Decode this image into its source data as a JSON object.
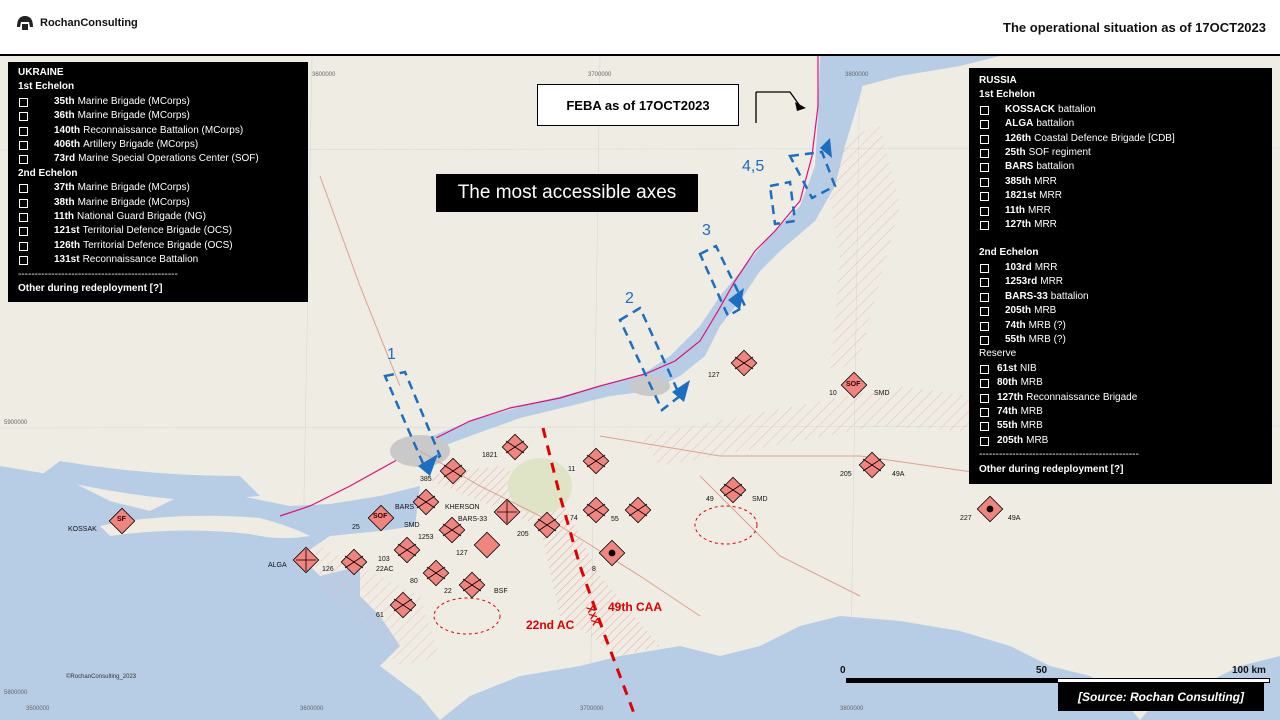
{
  "header": {
    "brand": "RochanConsulting",
    "title": "The operational situation as of 17OCT2023"
  },
  "ukraine": {
    "title": "UKRAINE",
    "echelon1_title": "1st Echelon",
    "echelon1": [
      {
        "num": "35th",
        "name": "Marine Brigade (MCorps)"
      },
      {
        "num": "36th",
        "name": "Marine Brigade (MCorps)"
      },
      {
        "num": "140th",
        "name": "Reconnaissance Battalion (MCorps)"
      },
      {
        "num": "406th",
        "name": "Artillery Brigade (MCorps)"
      },
      {
        "num": "73rd",
        "name": "Marine Special Operations Center (SOF)"
      }
    ],
    "echelon2_title": "2nd Echelon",
    "echelon2": [
      {
        "num": "37th",
        "name": "Marine Brigade (MCorps)"
      },
      {
        "num": "38th",
        "name": "Marine Brigade (MCorps)"
      },
      {
        "num": "11th",
        "name": "National Guard Brigade (NG)"
      },
      {
        "num": "121st",
        "name": "Territorial Defence Brigade (OCS)"
      },
      {
        "num": "126th",
        "name": "Territorial Defence Brigade (OCS)"
      },
      {
        "num": "131st",
        "name": "Reconnaissance Battalion"
      }
    ],
    "separator": "------------------------------------------------",
    "other": "Other during redeployment [?]"
  },
  "russia": {
    "title": "RUSSIA",
    "echelon1_title": "1st Echelon",
    "echelon1": [
      {
        "num": "KOSSACK",
        "name": "battalion"
      },
      {
        "num": "ALGA",
        "name": "battalion"
      },
      {
        "num": "126th",
        "name": "Coastal Defence Brigade [CDB]"
      },
      {
        "num": "25th",
        "name": "SOF regiment"
      },
      {
        "num": "BARS",
        "name": "battalion"
      },
      {
        "num": "385th",
        "name": "MRR"
      },
      {
        "num": "1821st",
        "name": "MRR"
      },
      {
        "num": "11th",
        "name": "MRR"
      },
      {
        "num": "127th",
        "name": "MRR"
      }
    ],
    "echelon2_title": "2nd Echelon",
    "echelon2": [
      {
        "num": "103rd",
        "name": "MRR"
      },
      {
        "num": "1253rd",
        "name": "MRR"
      },
      {
        "num": "BARS-33",
        "name": "battalion"
      },
      {
        "num": "205th",
        "name": "MRB"
      },
      {
        "num": "74th",
        "name": "MRB (?)"
      },
      {
        "num": "55th",
        "name": "MRB (?)"
      }
    ],
    "reserve_title": "Reserve",
    "reserve": [
      {
        "num": "61st",
        "name": "NIB"
      },
      {
        "num": "80th",
        "name": "MRB"
      },
      {
        "num": "127th",
        "name": "Reconnaissance Brigade"
      },
      {
        "num": "74th",
        "name": "MRB"
      },
      {
        "num": "55th",
        "name": "MRB"
      },
      {
        "num": "205th",
        "name": "MRB"
      }
    ],
    "separator": "------------------------------------------------",
    "other": "Other during redeployment [?]"
  },
  "callouts": {
    "feba": "FEBA as of 17OCT2023",
    "axes": "The most accessible axes",
    "source": "[Source: Rochan Consulting]",
    "copyright": "©RochanConsulting_2023"
  },
  "axes_numbers": [
    "1",
    "2",
    "3",
    "4,5"
  ],
  "boundary": {
    "corps_left": "22nd AC",
    "corps_right": "49th CAA"
  },
  "scale": {
    "zero": "0",
    "mid": "50",
    "end": "100 km"
  },
  "grid_labels": {
    "g1": "3600000",
    "g2": "3700000",
    "g3": "3800000",
    "g4": "3500000",
    "g5": "3600000",
    "g6": "3700000",
    "g7": "3800000",
    "g8": "5900000",
    "g9": "5800000"
  },
  "unit_labels": {
    "u385": "385",
    "u1821": "1821",
    "u11": "11",
    "u25": "25",
    "u103": "103",
    "u22ac": "22AC",
    "u1253": "1253",
    "ukherson": "KHERSON",
    "ubars": "BARS",
    "ubars33": "BARS-33",
    "u205a": "205",
    "u74": "74",
    "u55": "55",
    "u8": "8",
    "u127a": "127",
    "u80": "80",
    "u22": "22",
    "ubsf": "BSF",
    "u61": "61",
    "u126": "126",
    "ualga": "ALGA",
    "ukossak": "KOSSAK",
    "usmd1": "SMD",
    "u127b": "127",
    "u10": "10",
    "usmd2": "SMD",
    "u205b": "205",
    "u49a1": "49A",
    "u49": "49",
    "usmd3": "SMD",
    "u227": "227",
    "u49a2": "49A",
    "sof1": "SF",
    "sof2": "SOF",
    "sof3": "SOF"
  },
  "colors": {
    "water": "#b7cde6",
    "land": "#efece4",
    "unit_fill": "#f0857f",
    "axis_blue": "#1a6fc2",
    "boundary_red": "#e00000",
    "feba_line": "#e0107a"
  }
}
